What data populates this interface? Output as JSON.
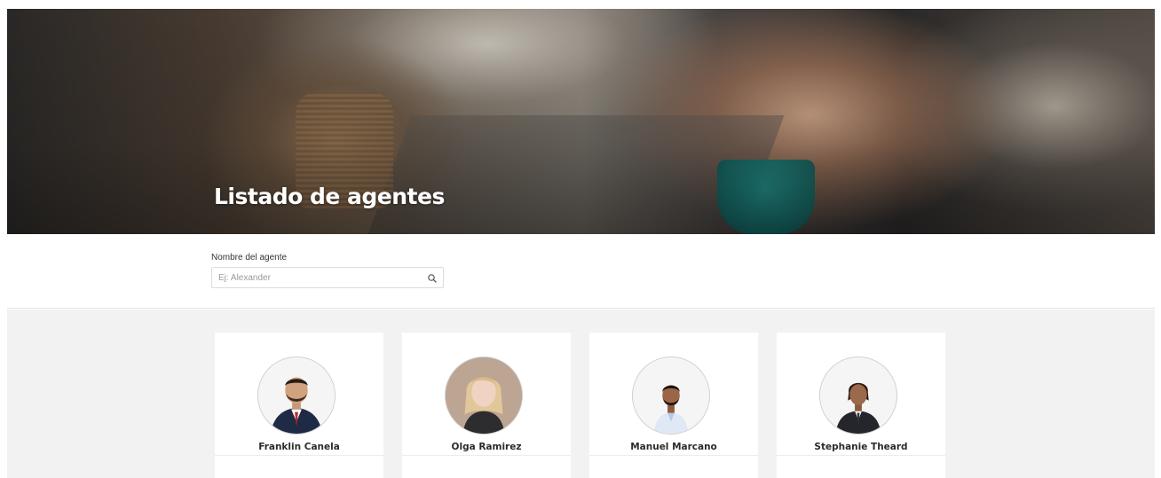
{
  "hero": {
    "title": "Listado de agentes"
  },
  "filter": {
    "label": "Nombre del agente",
    "placeholder": "Ej: Alexander",
    "value": ""
  },
  "agents": [
    {
      "name": "Franklin Canela",
      "photo": "franklin-canela-photo"
    },
    {
      "name": "Olga Ramirez",
      "photo": "olga-ramirez-photo"
    },
    {
      "name": "Manuel Marcano",
      "photo": "manuel-marcano-photo"
    },
    {
      "name": "Stephanie Theard",
      "photo": "stephanie-theard-photo"
    }
  ],
  "colors": {
    "page_background": "#ffffff",
    "list_background": "#f2f2f2",
    "card_background": "#ffffff",
    "name_text": "#2b2b2b",
    "hero_title": "#ffffff"
  }
}
